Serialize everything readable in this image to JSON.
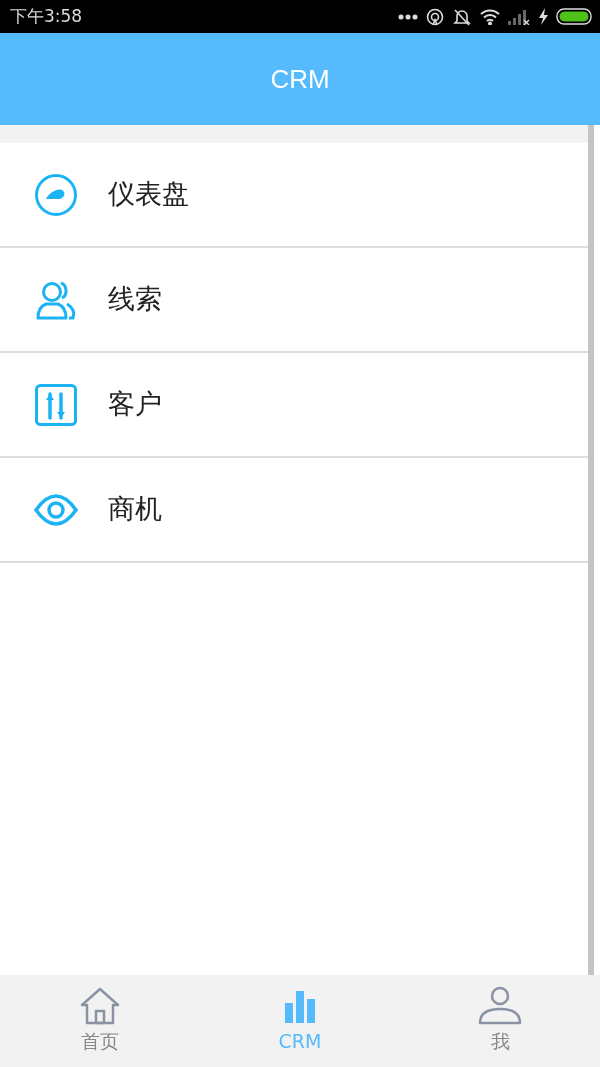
{
  "status_bar": {
    "time": "下午3:58"
  },
  "header": {
    "title": "CRM"
  },
  "menu": [
    {
      "label": "仪表盘"
    },
    {
      "label": "线索"
    },
    {
      "label": "客户"
    },
    {
      "label": "商机"
    }
  ],
  "tab_bar": [
    {
      "label": "首页",
      "selected": false
    },
    {
      "label": "CRM",
      "selected": true
    },
    {
      "label": "我",
      "selected": false
    }
  ]
}
